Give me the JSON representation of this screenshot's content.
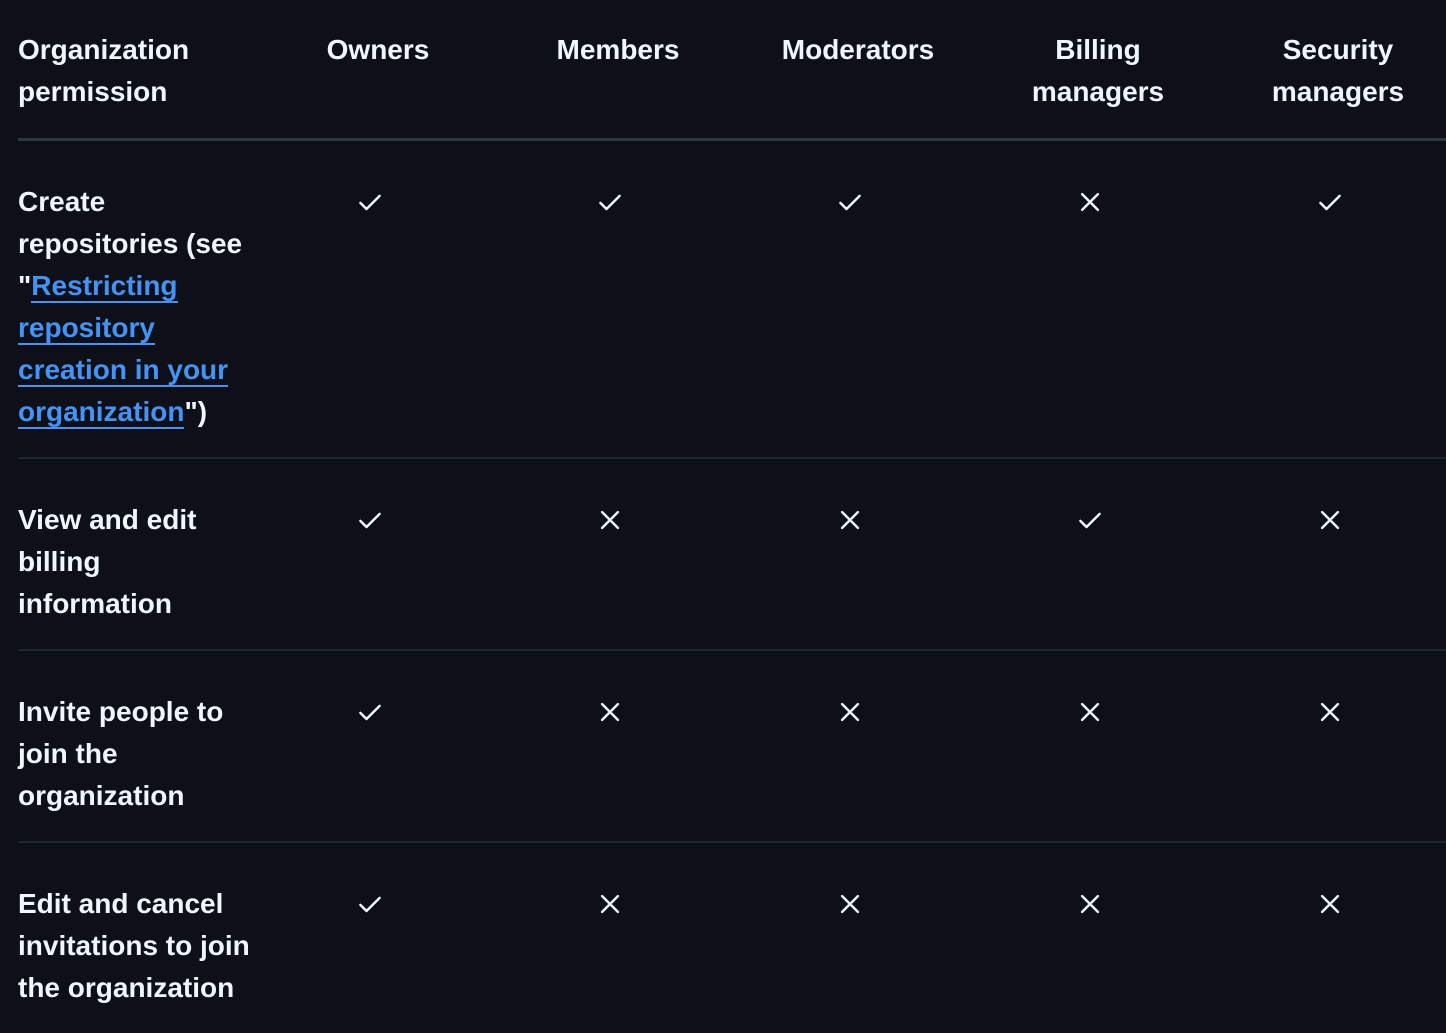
{
  "table": {
    "headers": [
      "Organization permission",
      "Owners",
      "Members",
      "Moderators",
      "Billing managers",
      "Security managers"
    ],
    "rows": [
      {
        "permission_prefix": "Create repositories (see \"",
        "link_text": "Restricting repository creation in your organization",
        "permission_suffix": "\")",
        "values": [
          "check",
          "check",
          "check",
          "cross",
          "check"
        ]
      },
      {
        "permission": "View and edit billing information",
        "values": [
          "check",
          "cross",
          "cross",
          "check",
          "cross"
        ]
      },
      {
        "permission": "Invite people to join the organization",
        "values": [
          "check",
          "cross",
          "cross",
          "cross",
          "cross"
        ]
      },
      {
        "permission": "Edit and cancel invitations to join the organization",
        "values": [
          "check",
          "cross",
          "cross",
          "cross",
          "cross"
        ]
      }
    ]
  },
  "icons": {
    "check": "check-icon",
    "cross": "x-icon"
  },
  "colors": {
    "background": "#0d1117",
    "text": "#f0f6fc",
    "link": "#4493f8",
    "border": "#30363d"
  }
}
